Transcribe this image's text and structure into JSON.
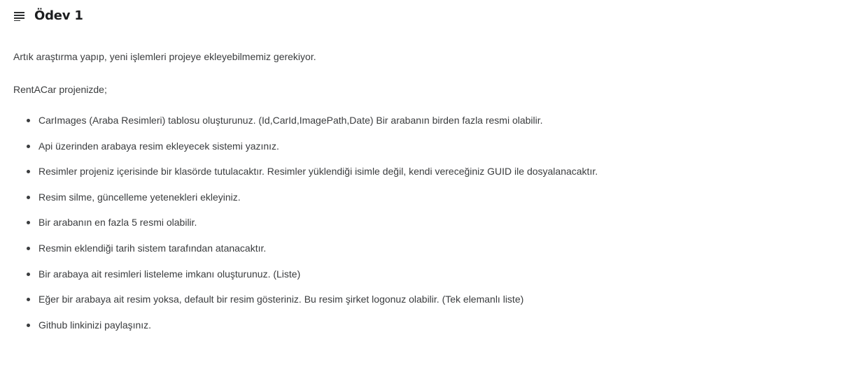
{
  "header": {
    "icon": "menu-lines-icon",
    "title": "Ödev 1"
  },
  "content": {
    "intro": "Artık araştırma yapıp, yeni işlemleri projeye ekleyebilmemiz gerekiyor.",
    "project_label": "RentACar projenizde;",
    "tasks": [
      "CarImages (Araba Resimleri) tablosu oluşturunuz. (Id,CarId,ImagePath,Date) Bir arabanın birden fazla resmi olabilir.",
      "Api üzerinden arabaya resim ekleyecek sistemi yazınız.",
      "Resimler projeniz içerisinde bir klasörde tutulacaktır. Resimler yüklendiği isimle değil, kendi vereceğiniz GUID ile dosyalanacaktır.",
      "Resim silme, güncelleme yetenekleri ekleyiniz.",
      "Bir arabanın en fazla 5 resmi olabilir.",
      "Resmin eklendiği tarih sistem tarafından atanacaktır.",
      "Bir arabaya ait resimleri listeleme imkanı oluşturunuz. (Liste)",
      "Eğer bir arabaya ait resim yoksa, default bir resim gösteriniz. Bu resim şirket logonuz olabilir. (Tek elemanlı liste)",
      "Github linkinizi paylaşınız."
    ]
  }
}
